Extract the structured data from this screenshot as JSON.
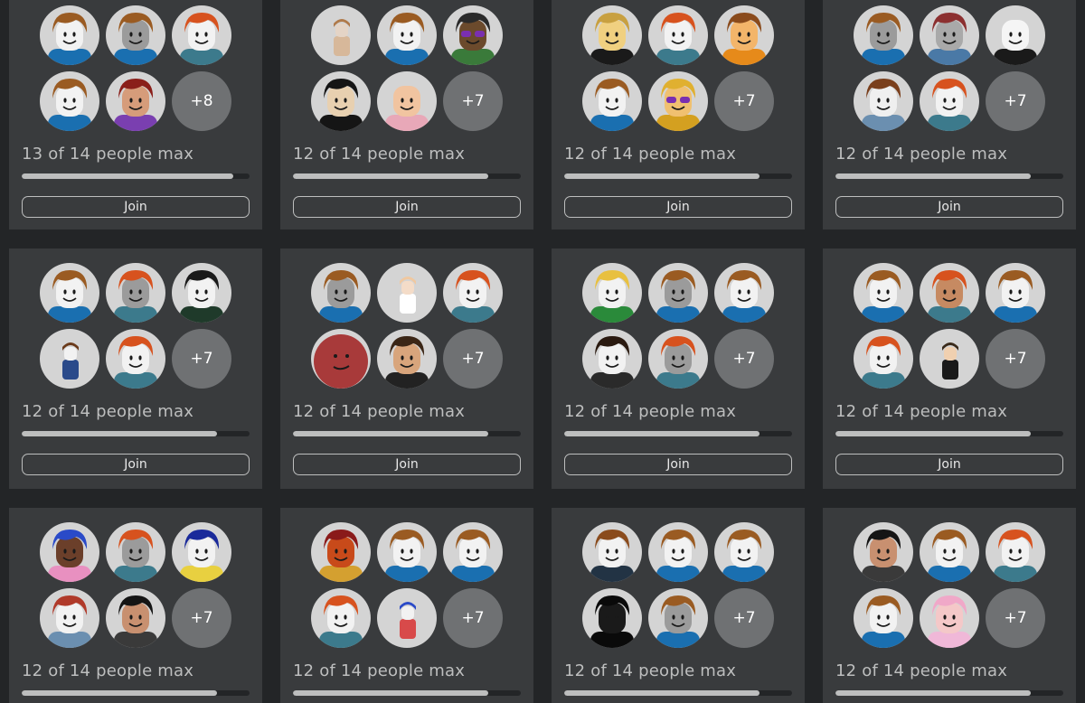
{
  "colors": {
    "page_background": "#232527",
    "card_background": "#393b3d",
    "avatar_background": "#d4d4d4",
    "overflow_badge": "#6f7173",
    "text_muted": "#bdbebe",
    "progress_track": "#232527",
    "progress_fill": "#bdbebe"
  },
  "join_label": "Join",
  "servers": [
    {
      "players": [
        "brown-hair-white",
        "brown-hair-gray",
        "orange-hair-white",
        "brown-hair-white",
        "red-hair-girl-purple"
      ],
      "overflow": "+8",
      "capacity_text": "13 of 14 people max",
      "fill_ratio": 0.929
    },
    {
      "players": [
        "tiny-figure",
        "brown-hair-white",
        "purple-shades-dark",
        "black-hair-grin",
        "smiling-face",
        "none"
      ],
      "overflow": "+7",
      "capacity_text": "12 of 14 people max",
      "fill_ratio": 0.857
    },
    {
      "players": [
        "party-hat-blonde",
        "orange-hair-white",
        "brown-hair-orange",
        "brown-hair-white",
        "blonde-shades-gold"
      ],
      "overflow": "+7",
      "capacity_text": "12 of 14 people max",
      "fill_ratio": 0.857
    },
    {
      "players": [
        "brown-hair-gray",
        "red-cap-gray",
        "white-headless",
        "brown-hair-blue",
        "orange-hair-white"
      ],
      "overflow": "+7",
      "capacity_text": "12 of 14 people max",
      "fill_ratio": 0.857
    },
    {
      "players": [
        "brown-hair-white",
        "orange-hair-gray",
        "black-hair-guy",
        "small-figure-waving",
        "orange-hair-white"
      ],
      "overflow": "+7",
      "capacity_text": "12 of 14 people max",
      "fill_ratio": 0.857
    },
    {
      "players": [
        "brown-hair-gray",
        "tiny-girl",
        "orange-hair-white",
        "red-ball",
        "brown-hair-man"
      ],
      "overflow": "+7",
      "capacity_text": "12 of 14 people max",
      "fill_ratio": 0.857
    },
    {
      "players": [
        "blonde-smirk",
        "brown-hair-gray",
        "brown-hair-white",
        "black-hair-smile",
        "orange-hair-gray"
      ],
      "overflow": "+7",
      "capacity_text": "12 of 14 people max",
      "fill_ratio": 0.857
    },
    {
      "players": [
        "brown-hair-white",
        "orange-hair-tan",
        "brown-hair-white",
        "orange-hair-white",
        "horned-figure"
      ],
      "overflow": "+7",
      "capacity_text": "12 of 14 people max",
      "fill_ratio": 0.857
    },
    {
      "players": [
        "blue-hair-dark",
        "orange-hair-gray",
        "blue-hair-yellow",
        "red-cap-white",
        "black-hair-woman"
      ],
      "overflow": "+7",
      "capacity_text": "12 of 14 people max",
      "fill_ratio": 0.857
    },
    {
      "players": [
        "red-dragon-costume",
        "brown-hair-white",
        "brown-hair-white",
        "orange-hair-white",
        "blue-hair-figure"
      ],
      "overflow": "+7",
      "capacity_text": "12 of 14 people max",
      "fill_ratio": 0.857
    },
    {
      "players": [
        "brown-hair-suit",
        "brown-hair-white",
        "brown-hair-white",
        "black-cat-hood",
        "brown-hair-gray"
      ],
      "overflow": "+7",
      "capacity_text": "12 of 14 people max",
      "fill_ratio": 0.857
    },
    {
      "players": [
        "black-hair-woman",
        "brown-hair-white",
        "orange-hair-white",
        "brown-hair-white",
        "pink-hair-girl"
      ],
      "overflow": "+7",
      "capacity_text": "12 of 14 people max",
      "fill_ratio": 0.857
    }
  ]
}
